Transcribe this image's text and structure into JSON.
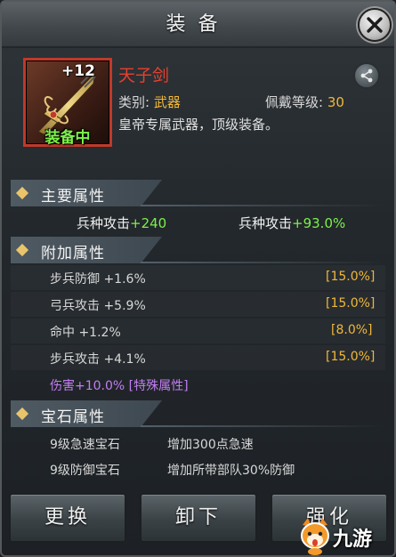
{
  "header": {
    "title": "装备"
  },
  "item": {
    "plus_level": "+12",
    "equipped_label": "装备中",
    "name": "天子剑",
    "category_label": "类别:",
    "category_value": "武器",
    "level_label": "佩戴等级:",
    "level_value": "30",
    "description": "皇帝专属武器，顶级装备。",
    "name_color": "#e8402e",
    "frame_color": "#c0392b"
  },
  "main_attrs": {
    "title": "主要属性",
    "items": [
      {
        "label": "兵种攻击",
        "value": "+240"
      },
      {
        "label": "兵种攻击",
        "value": "+93.0%"
      }
    ]
  },
  "extra_attrs": {
    "title": "附加属性",
    "items": [
      {
        "label": "步兵防御",
        "value": "+1.6%",
        "max": "[15.0%]"
      },
      {
        "label": "弓兵攻击",
        "value": "+5.9%",
        "max": "[15.0%]"
      },
      {
        "label": "命中",
        "value": "+1.2%",
        "max": "[8.0%]"
      },
      {
        "label": "步兵攻击",
        "value": "+4.1%",
        "max": "[15.0%]"
      }
    ],
    "special": "伤害+10.0% [特殊属性]"
  },
  "gem_attrs": {
    "title": "宝石属性",
    "items": [
      {
        "name": "9级急速宝石",
        "effect": "增加300点急速"
      },
      {
        "name": "9级防御宝石",
        "effect": "增加所带部队30%防御"
      }
    ]
  },
  "buttons": {
    "replace": "更换",
    "unequip": "卸下",
    "enhance": "强化"
  },
  "watermark": {
    "text": "九游"
  },
  "colors": {
    "accent_gold": "#f0b83a",
    "bonus_green": "#7cf04a",
    "special_purple": "#c27ef2"
  }
}
